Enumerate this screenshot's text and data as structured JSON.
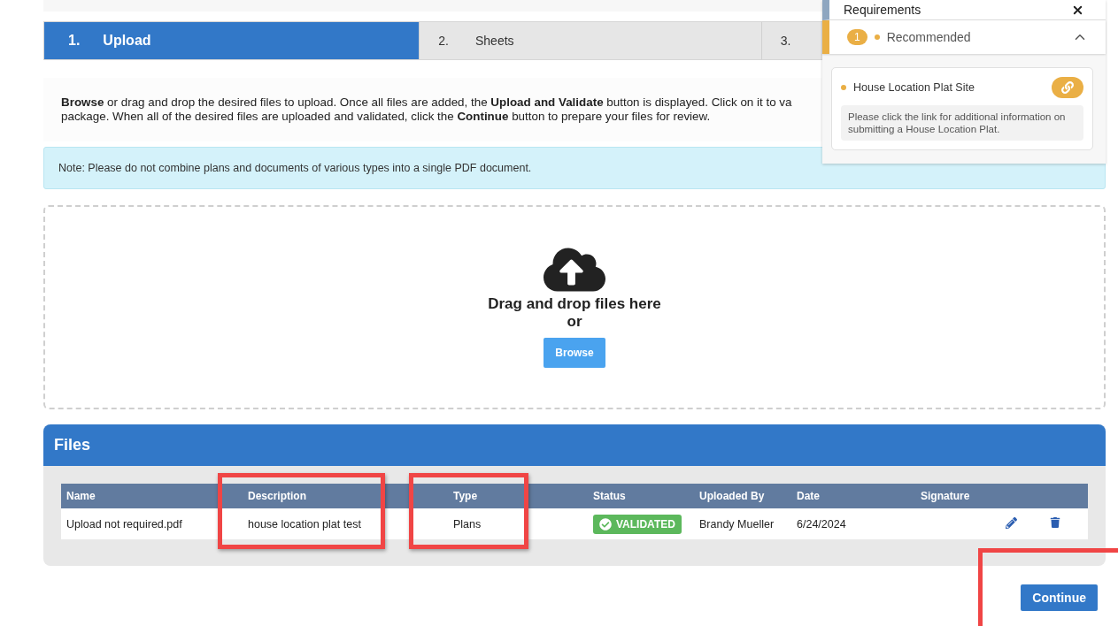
{
  "steps": [
    {
      "number": "1.",
      "label": "Upload",
      "selected": true
    },
    {
      "number": "2.",
      "label": "Sheets",
      "selected": false
    },
    {
      "number": "3.",
      "selected": false
    }
  ],
  "instructions": [
    "**Browse** or drag and drop the desired files to upload. Once all files are added, the **Upload and Validate** button is displayed. Click on it to va",
    "package. When all of the desired files are uploaded and validated, click the **Continue** button to prepare your files for review."
  ],
  "note": "Note: Please do not combine plans and documents of various types into a single PDF document.",
  "dropzone": {
    "title": "Drag and drop files here",
    "or": "or",
    "button": "Browse"
  },
  "files": {
    "title": "Files",
    "columns": [
      {
        "label": "Name",
        "highlighted": false
      },
      {
        "label": "Description",
        "highlighted": true
      },
      {
        "label": "Type",
        "highlighted": true
      },
      {
        "label": "Status",
        "highlighted": false
      },
      {
        "label": "Uploaded By",
        "highlighted": false
      },
      {
        "label": "Date",
        "highlighted": false
      },
      {
        "label": "Signature",
        "highlighted": false
      }
    ],
    "rows": [
      {
        "name": "Upload not required.pdf",
        "description": "house location plat test",
        "type": "Plans",
        "status": "VALIDATED",
        "uploaded_by": "Brandy Mueller",
        "date": "6/24/2024"
      }
    ]
  },
  "continue_button": {
    "label": "Continue",
    "highlighted": true
  },
  "requirements_panel": {
    "title": "Requirements",
    "group": {
      "count": "1",
      "label": "Recommended",
      "expanded": true,
      "items": [
        {
          "title": "House Location Plat Site",
          "description": "Please click the link for additional information on submitting a House Location Plat."
        }
      ]
    }
  }
}
